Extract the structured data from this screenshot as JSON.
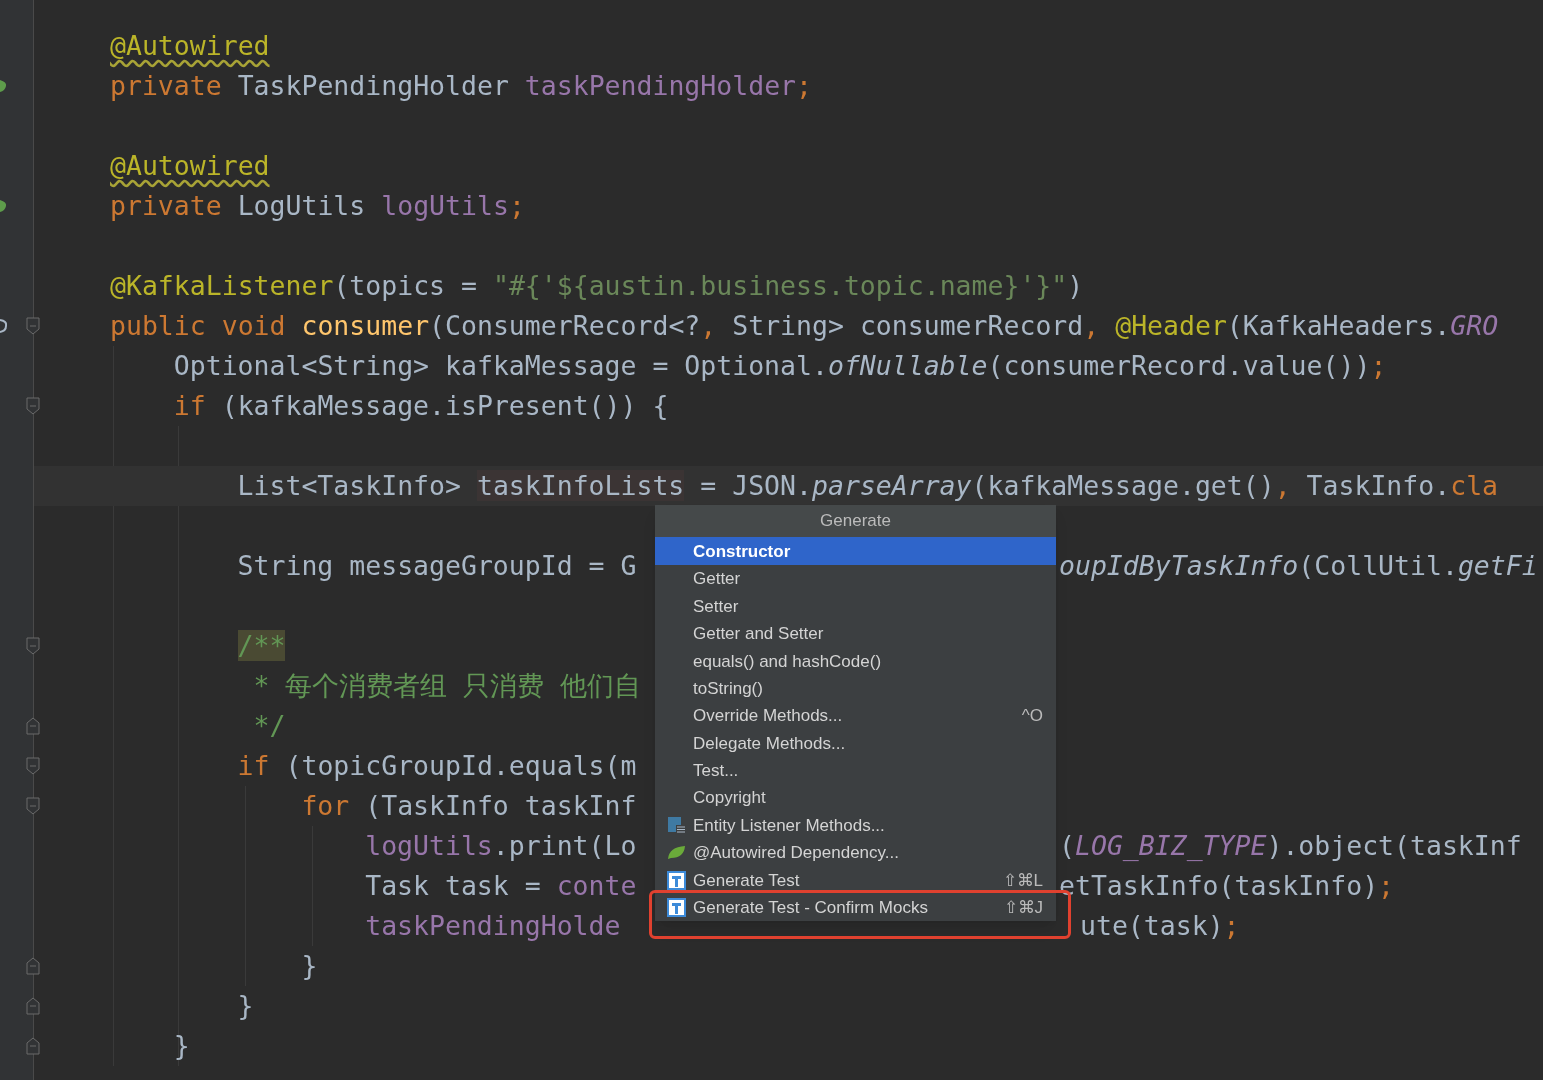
{
  "editor": {
    "lines": [
      {
        "kind": "code",
        "parts": [
          [
            {
              "kind": "annotation-warning",
              "text": "@Autowired"
            }
          ]
        ]
      },
      {
        "kind": "code",
        "gutter": {
          "kind": "bean"
        },
        "parts": [
          [
            {
              "kind": "keyword",
              "text": "private "
            },
            {
              "kind": "plain",
              "text": "TaskPendingHolder "
            },
            {
              "kind": "field",
              "text": "taskPendingHolder"
            },
            {
              "kind": "keyword",
              "text": ";"
            }
          ]
        ]
      },
      {
        "kind": "blank"
      },
      {
        "kind": "code",
        "parts": [
          [
            {
              "kind": "annotation-warning",
              "text": "@Autowired"
            }
          ]
        ]
      },
      {
        "kind": "code",
        "gutter": {
          "kind": "bean"
        },
        "parts": [
          [
            {
              "kind": "keyword",
              "text": "private "
            },
            {
              "kind": "plain",
              "text": "LogUtils "
            },
            {
              "kind": "field",
              "text": "logUtils"
            },
            {
              "kind": "keyword",
              "text": ";"
            }
          ]
        ]
      },
      {
        "kind": "blank"
      },
      {
        "kind": "code",
        "parts": [
          [
            {
              "kind": "annotation",
              "text": "@KafkaListener"
            },
            {
              "kind": "plain",
              "text": "(topics = "
            },
            {
              "kind": "string",
              "text": "\"#{'${austin.business.topic.name}'}\""
            },
            {
              "kind": "plain",
              "text": ")"
            }
          ]
        ]
      },
      {
        "kind": "code",
        "gutter": {
          "kind": "at"
        },
        "fold": {
          "kind": "start"
        },
        "parts": [
          [
            {
              "kind": "keyword",
              "text": "public void "
            },
            {
              "kind": "declaration",
              "text": "consumer"
            },
            {
              "kind": "plain",
              "text": "(ConsumerRecord<?"
            },
            {
              "kind": "keyword",
              "text": ", "
            },
            {
              "kind": "plain",
              "text": "String> consumerRecord"
            },
            {
              "kind": "keyword",
              "text": ", "
            },
            {
              "kind": "annotation",
              "text": "@Header"
            },
            {
              "kind": "plain",
              "text": "(KafkaHeaders."
            },
            {
              "kind": "constant",
              "text": "GRO"
            }
          ]
        ],
        "children": [
          {
            "kind": "code",
            "parts": [
              [
                {
                  "kind": "plain",
                  "text": "Optional<String> kafkaMessage = Optional."
                },
                {
                  "kind": "static",
                  "text": "ofNullable"
                },
                {
                  "kind": "plain",
                  "text": "(consumerRecord.value())"
                },
                {
                  "kind": "keyword",
                  "text": ";"
                }
              ]
            ]
          },
          {
            "kind": "code",
            "fold": {
              "kind": "start"
            },
            "parts": [
              [
                {
                  "kind": "keyword",
                  "text": "if "
                },
                {
                  "kind": "plain",
                  "text": "(kafkaMessage.isPresent()) {"
                }
              ]
            ],
            "children": [
              {
                "kind": "blank"
              },
              {
                "kind": "code",
                "current": true,
                "parts": [
                  [
                    {
                      "kind": "plain",
                      "text": "List<TaskInfo> "
                    },
                    {
                      "kind": "highlight",
                      "text": "taskInfoLists"
                    },
                    {
                      "kind": "plain",
                      "text": " = JSON."
                    },
                    {
                      "kind": "static",
                      "text": "parseArray"
                    },
                    {
                      "kind": "plain",
                      "text": "(kafkaMessage.get()"
                    },
                    {
                      "kind": "keyword",
                      "text": ", "
                    },
                    {
                      "kind": "plain",
                      "text": "TaskInfo."
                    },
                    {
                      "kind": "keyword",
                      "text": "cla"
                    }
                  ]
                ]
              },
              {
                "kind": "blank"
              },
              {
                "kind": "code",
                "parts": [
                  [
                    {
                      "kind": "plain",
                      "text": "String messageGroupId = G"
                    }
                  ],
                  [
                    {
                      "kind": "static",
                      "text": "oupIdByTaskInfo"
                    },
                    {
                      "kind": "plain",
                      "text": "(CollUtil."
                    },
                    {
                      "kind": "static",
                      "text": "getFi"
                    }
                  ]
                ]
              },
              {
                "kind": "blank"
              },
              {
                "kind": "code",
                "fold": {
                  "kind": "start"
                },
                "parts": [
                  [
                    {
                      "kind": "doc-highlight",
                      "text": "/**"
                    }
                  ]
                ]
              },
              {
                "kind": "code",
                "parts": [
                  [
                    {
                      "kind": "doc",
                      "text": " * 每个消费者组 只消费 他们自"
                    }
                  ]
                ]
              },
              {
                "kind": "code",
                "fold": {
                  "kind": "end"
                },
                "parts": [
                  [
                    {
                      "kind": "doc",
                      "text": " */"
                    }
                  ]
                ]
              },
              {
                "kind": "code",
                "fold": {
                  "kind": "start"
                },
                "parts": [
                  [
                    {
                      "kind": "keyword",
                      "text": "if "
                    },
                    {
                      "kind": "plain",
                      "text": "(topicGroupId.equals(m"
                    }
                  ]
                ],
                "children": [
                  {
                    "kind": "code",
                    "fold": {
                      "kind": "start"
                    },
                    "parts": [
                      [
                        {
                          "kind": "keyword",
                          "text": "for "
                        },
                        {
                          "kind": "plain",
                          "text": "(TaskInfo taskInf"
                        }
                      ]
                    ],
                    "children": [
                      {
                        "kind": "code",
                        "parts": [
                          [
                            {
                              "kind": "field",
                              "text": "logUtils"
                            },
                            {
                              "kind": "plain",
                              "text": ".print(Lo"
                            }
                          ],
                          [
                            {
                              "kind": "plain",
                              "text": "("
                            },
                            {
                              "kind": "constant",
                              "text": "LOG_BIZ_TYPE"
                            },
                            {
                              "kind": "plain",
                              "text": ").object(taskInf"
                            }
                          ]
                        ]
                      },
                      {
                        "kind": "code",
                        "parts": [
                          [
                            {
                              "kind": "plain",
                              "text": "Task task = "
                            },
                            {
                              "kind": "field",
                              "text": "conte"
                            }
                          ],
                          [
                            {
                              "kind": "plain",
                              "text": "etTaskInfo(taskInfo)"
                            },
                            {
                              "kind": "keyword",
                              "text": ";"
                            }
                          ]
                        ]
                      },
                      {
                        "kind": "code",
                        "parts": [
                          [
                            {
                              "kind": "field",
                              "text": "taskPendingHolde"
                            }
                          ],
                          [
                            {
                              "kind": "plain",
                              "text": "ute(task)"
                            },
                            {
                              "kind": "keyword",
                              "text": ";"
                            }
                          ]
                        ]
                      }
                    ]
                  },
                  {
                    "kind": "code",
                    "fold": {
                      "kind": "end"
                    },
                    "parts": [
                      [
                        {
                          "kind": "plain",
                          "text": "}"
                        }
                      ]
                    ]
                  }
                ]
              },
              {
                "kind": "code",
                "fold": {
                  "kind": "end"
                },
                "parts": [
                  [
                    {
                      "kind": "plain",
                      "text": "}"
                    }
                  ]
                ]
              }
            ]
          },
          {
            "kind": "code",
            "fold": {
              "kind": "end"
            },
            "parts": [
              [
                {
                  "kind": "plain",
                  "text": "}"
                }
              ]
            ]
          }
        ]
      }
    ]
  },
  "popup": {
    "title": "Generate",
    "items": [
      {
        "label": "Constructor",
        "selected": true,
        "outlined": false
      },
      {
        "label": "Getter",
        "selected": false,
        "outlined": false
      },
      {
        "label": "Setter",
        "selected": false,
        "outlined": false
      },
      {
        "label": "Getter and Setter",
        "selected": false,
        "outlined": false
      },
      {
        "label": "equals() and hashCode()",
        "selected": false,
        "outlined": false
      },
      {
        "label": "toString()",
        "selected": false,
        "outlined": false
      },
      {
        "label": "Override Methods...",
        "shortcut": "^O",
        "selected": false,
        "outlined": false
      },
      {
        "label": "Delegate Methods...",
        "selected": false,
        "outlined": false
      },
      {
        "label": "Test...",
        "selected": false,
        "outlined": false
      },
      {
        "label": "Copyright",
        "selected": false,
        "outlined": false
      },
      {
        "kind": "entity",
        "label": "Entity Listener Methods...",
        "selected": false,
        "outlined": false
      },
      {
        "kind": "spring",
        "label": "@Autowired Dependency...",
        "selected": false,
        "outlined": false
      },
      {
        "kind": "test",
        "label": "Generate Test",
        "shortcut": "⇧⌘L",
        "selected": false,
        "outlined": false
      },
      {
        "kind": "test",
        "label": "Generate Test - Confirm Mocks",
        "shortcut": "⇧⌘J",
        "selected": false,
        "outlined": true
      }
    ]
  }
}
